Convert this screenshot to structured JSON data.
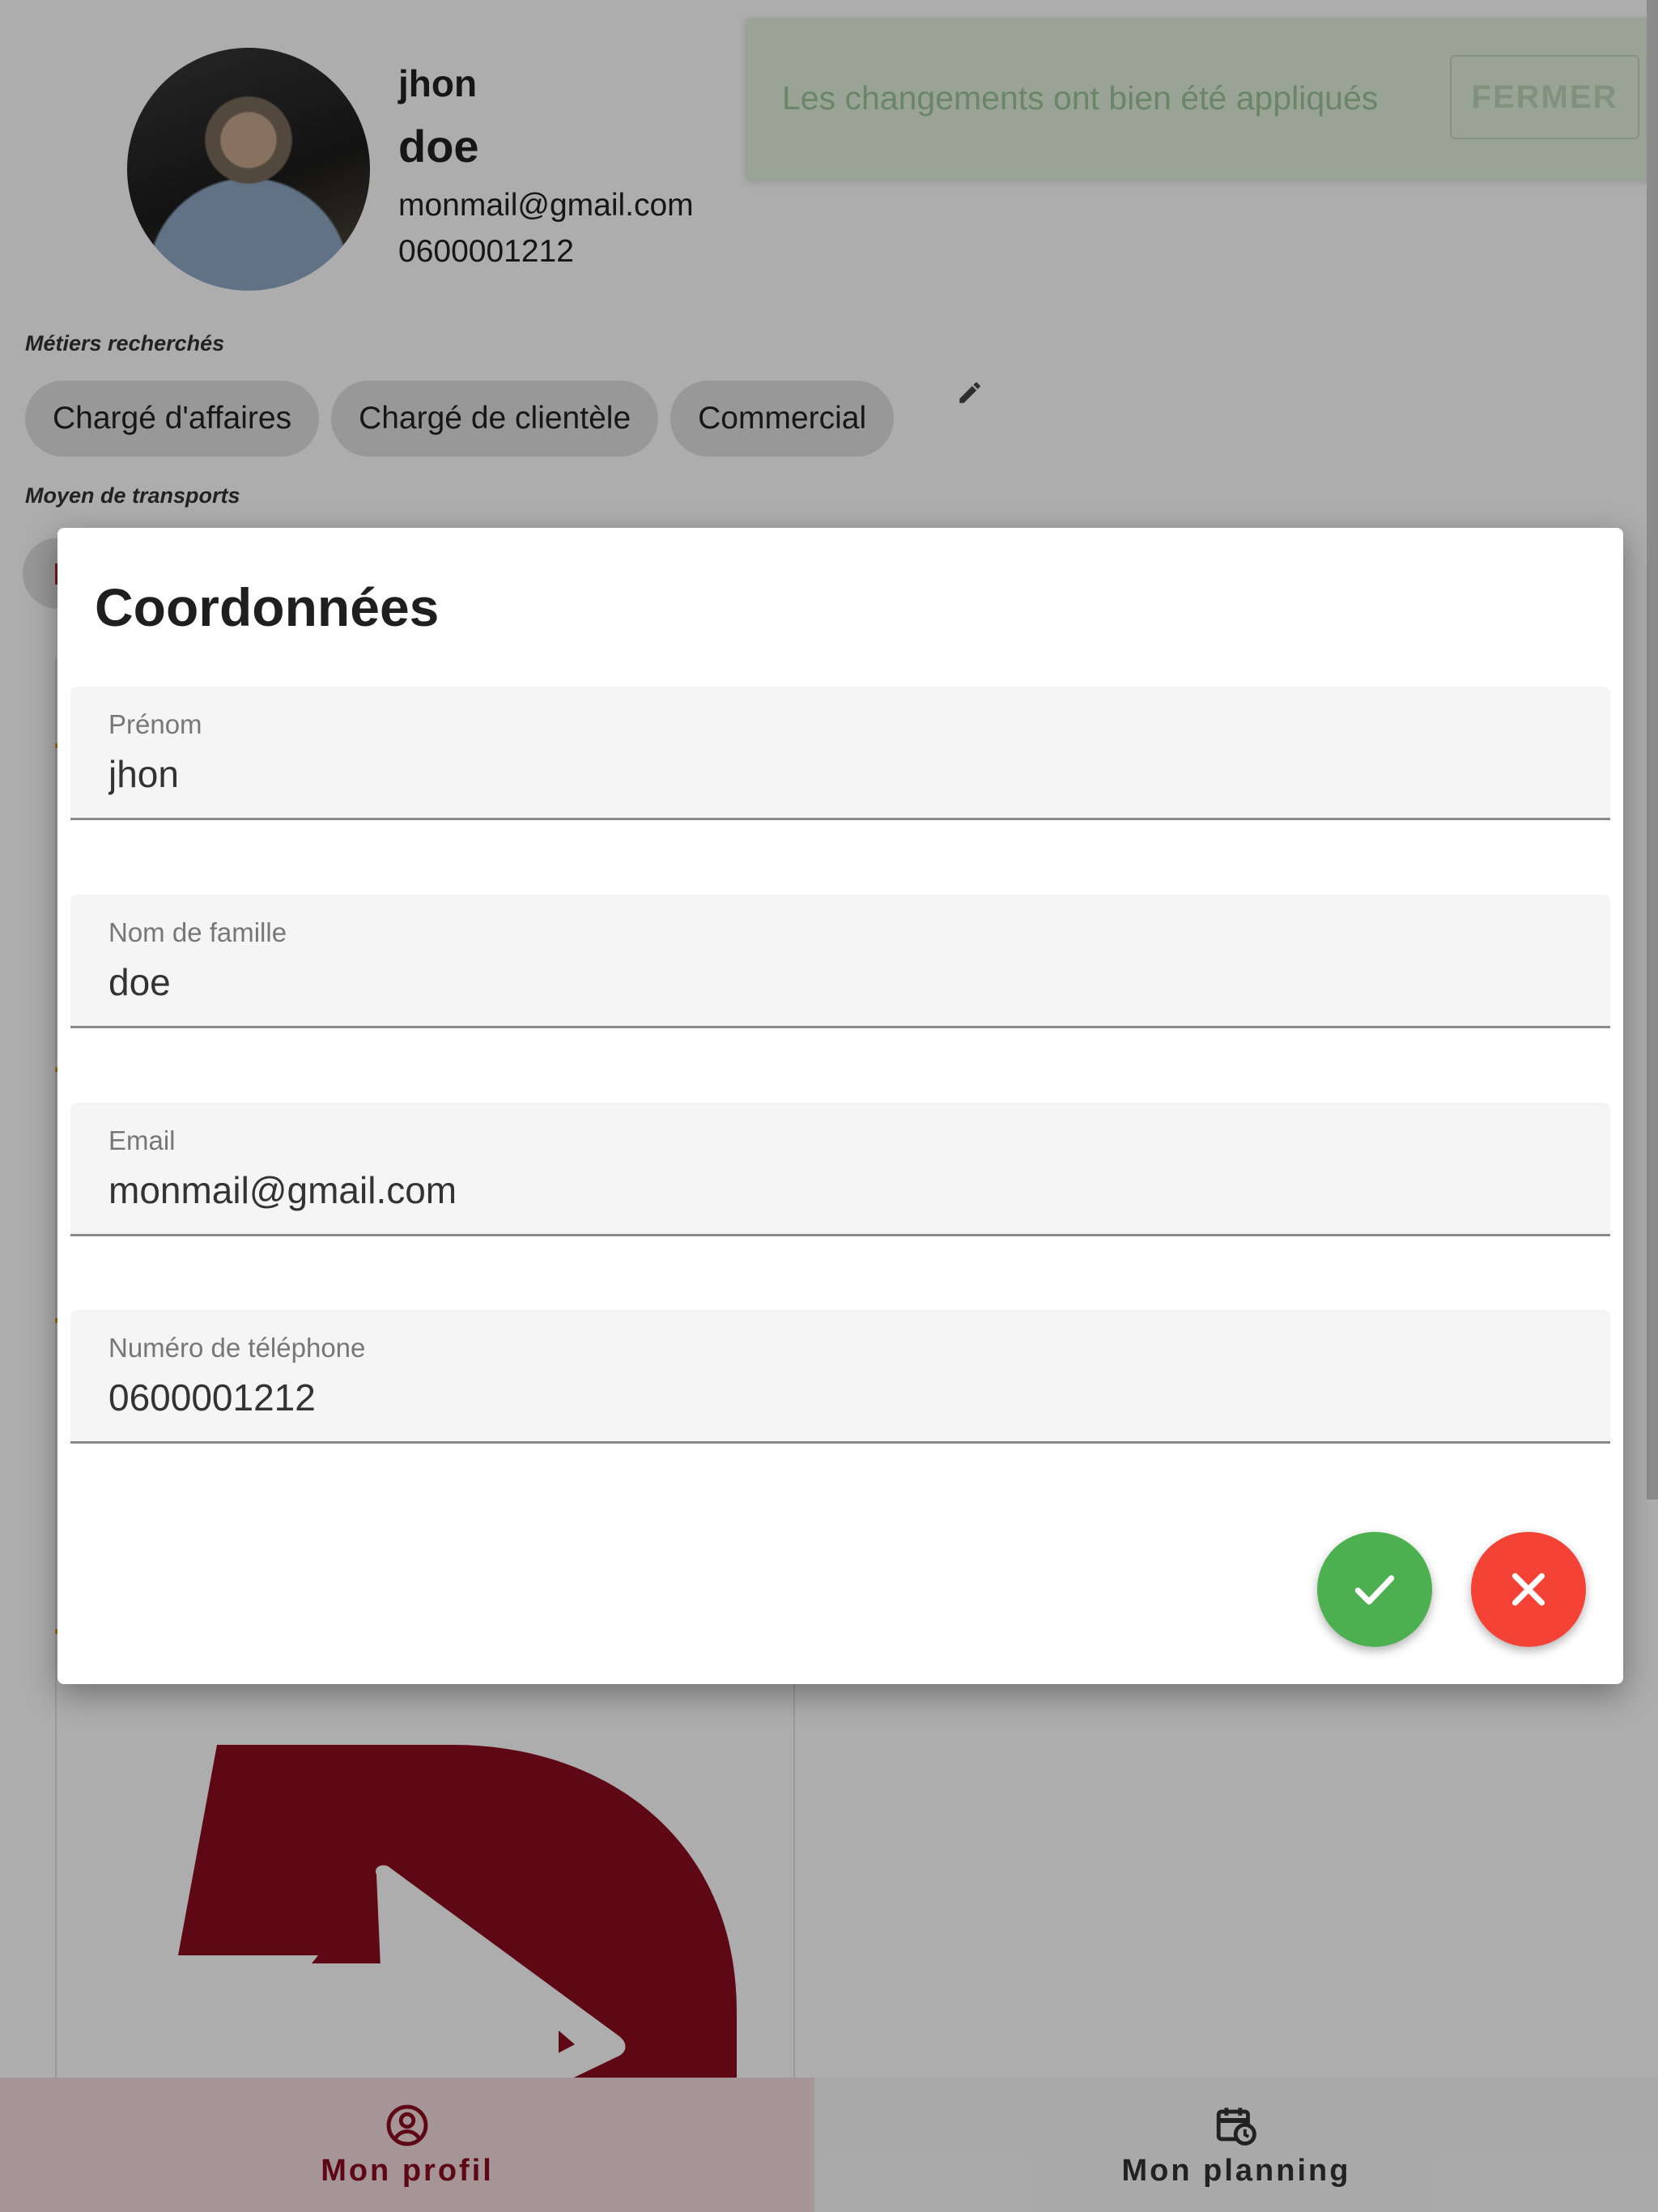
{
  "profile": {
    "first_name": "jhon",
    "last_name": "doe",
    "email": "monmail@gmail.com",
    "phone": "0600001212",
    "jobs_label": "Métiers recherchés",
    "jobs": [
      "Chargé d'affaires",
      "Chargé de clientèle",
      "Commercial"
    ],
    "transport_label": "Moyen de transports"
  },
  "toast": {
    "message": "Les changements ont bien été appliqués",
    "close_label": "FERMER"
  },
  "dialog": {
    "title": "Coordonnées",
    "fields": [
      {
        "label": "Prénom",
        "value": "jhon"
      },
      {
        "label": "Nom de famille",
        "value": "doe"
      },
      {
        "label": "Email",
        "value": "monmail@gmail.com"
      },
      {
        "label": "Numéro de téléphone",
        "value": "0600001212"
      }
    ],
    "confirm_icon": "check-icon",
    "cancel_icon": "close-icon"
  },
  "nav": {
    "items": [
      {
        "label": "Mon profil",
        "icon": "account-circle-icon",
        "active": true
      },
      {
        "label": "Mon planning",
        "icon": "calendar-clock-icon",
        "active": false
      }
    ]
  },
  "colors": {
    "brand": "#8c0d1f",
    "confirm": "#4caf50",
    "cancel": "#f44336",
    "toast_bg": "#e3f2dd"
  }
}
